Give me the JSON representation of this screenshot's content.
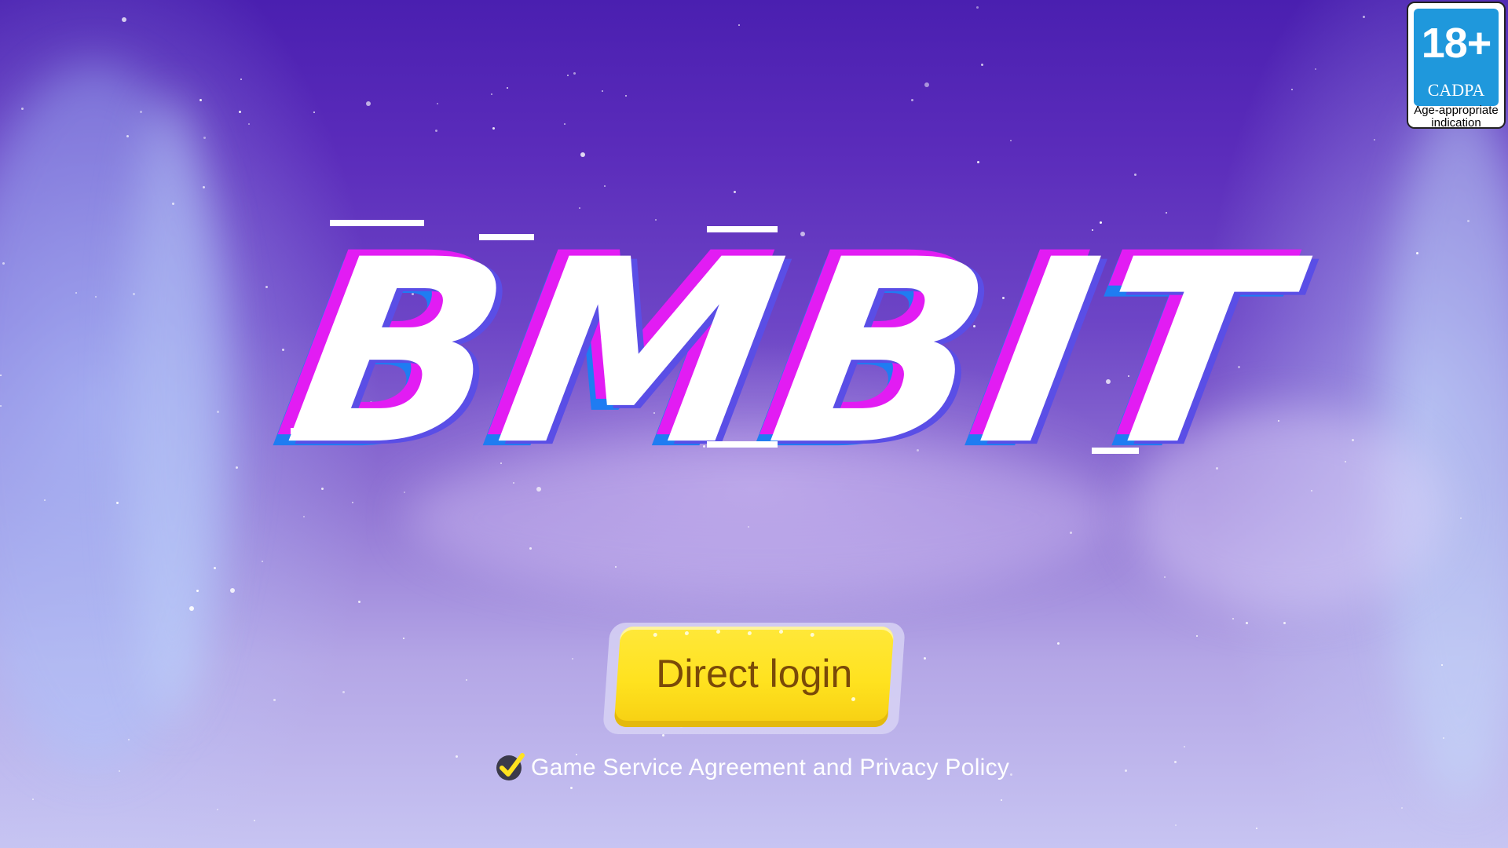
{
  "logo": {
    "text": "BMBIT",
    "colors": {
      "main": "#ffffff",
      "shadow_magenta": "#e21cf3",
      "shadow_blue": "#1f7cf2"
    }
  },
  "age_badge": {
    "age": "18+",
    "org": "CADPA",
    "caption": "Age-appropriate indication",
    "color": "#1f98dc"
  },
  "login": {
    "label": "Direct login",
    "color": "#ffe21f",
    "text_color": "#7a4a08"
  },
  "agreement": {
    "checked": true,
    "check_icon": "checkmark-icon",
    "text": "Game Service Agreement and Privacy Policy"
  }
}
